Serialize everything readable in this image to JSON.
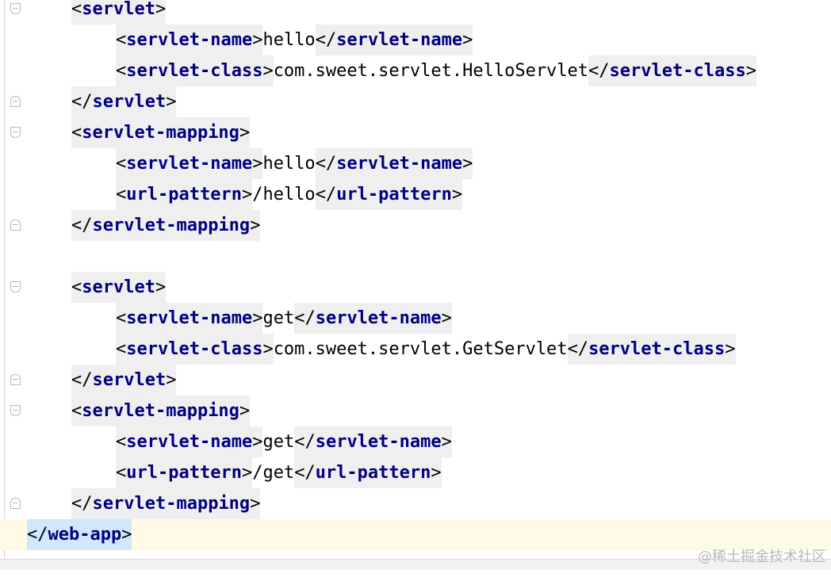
{
  "editor": {
    "language": "xml",
    "lines": [
      {
        "open": "servlet"
      },
      {
        "open": "servlet-name",
        "text": "hello",
        "close": "servlet-name"
      },
      {
        "open": "servlet-class",
        "text": "com.sweet.servlet.HelloServlet",
        "close": "servlet-class"
      },
      {
        "close": "servlet"
      },
      {
        "open": "servlet-mapping"
      },
      {
        "open": "servlet-name",
        "text": "hello",
        "close": "servlet-name"
      },
      {
        "open": "url-pattern",
        "text": "/hello",
        "close": "url-pattern"
      },
      {
        "close": "servlet-mapping"
      },
      {},
      {
        "open": "servlet"
      },
      {
        "open": "servlet-name",
        "text": "get",
        "close": "servlet-name"
      },
      {
        "open": "servlet-class",
        "text": "com.sweet.servlet.GetServlet",
        "close": "servlet-class"
      },
      {
        "close": "servlet"
      },
      {
        "open": "servlet-mapping"
      },
      {
        "open": "servlet-name",
        "text": "get",
        "close": "servlet-name"
      },
      {
        "open": "url-pattern",
        "text": "/get",
        "close": "url-pattern"
      },
      {
        "close": "servlet-mapping"
      },
      {
        "close": "web-app"
      }
    ]
  },
  "watermark": "@稀土掘金技术社区"
}
